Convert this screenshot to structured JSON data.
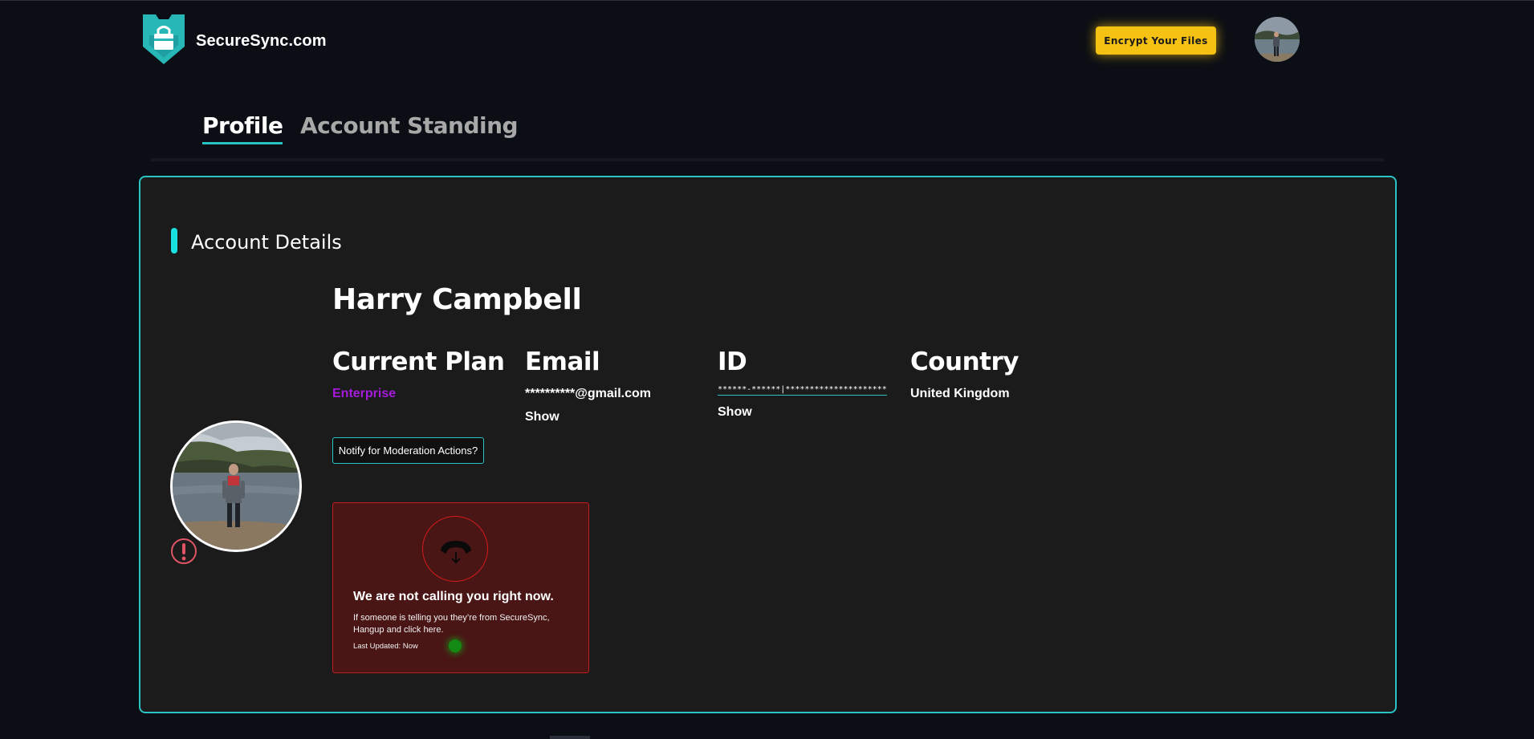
{
  "header": {
    "brand": "SecureSync.com",
    "cta_label": "Encrypt Your Files"
  },
  "tabs": [
    {
      "label": "Profile",
      "active": true
    },
    {
      "label": "Account Standing",
      "active": false
    }
  ],
  "section": {
    "title": "Account Details"
  },
  "profile": {
    "name": "Harry Campbell",
    "plan_label": "Current Plan",
    "plan_value": "Enterprise",
    "email_label": "Email",
    "email_value": "**********@gmail.com",
    "email_show": "Show",
    "id_label": "ID",
    "id_value": "******-******|*********************",
    "id_show": "Show",
    "country_label": "Country",
    "country_value": "United Kingdom",
    "notify_label": "Notify for Moderation Actions?"
  },
  "call_warning": {
    "title": "We are not calling you right now.",
    "body": "If someone is telling you they’re from SecureSync, Hangup and click here.",
    "updated": "Last Updated: Now"
  },
  "colors": {
    "accent": "#2bc4c4",
    "cta": "#f5c112",
    "plan": "#a51bdb",
    "warning_bg": "#4a1515",
    "warning_border": "#c21d1d",
    "status_ok": "#138a13"
  },
  "icons": {
    "logo": "shield-lock-icon",
    "warning": "exclamation-circle-icon",
    "phone": "phone-hangup-icon"
  }
}
